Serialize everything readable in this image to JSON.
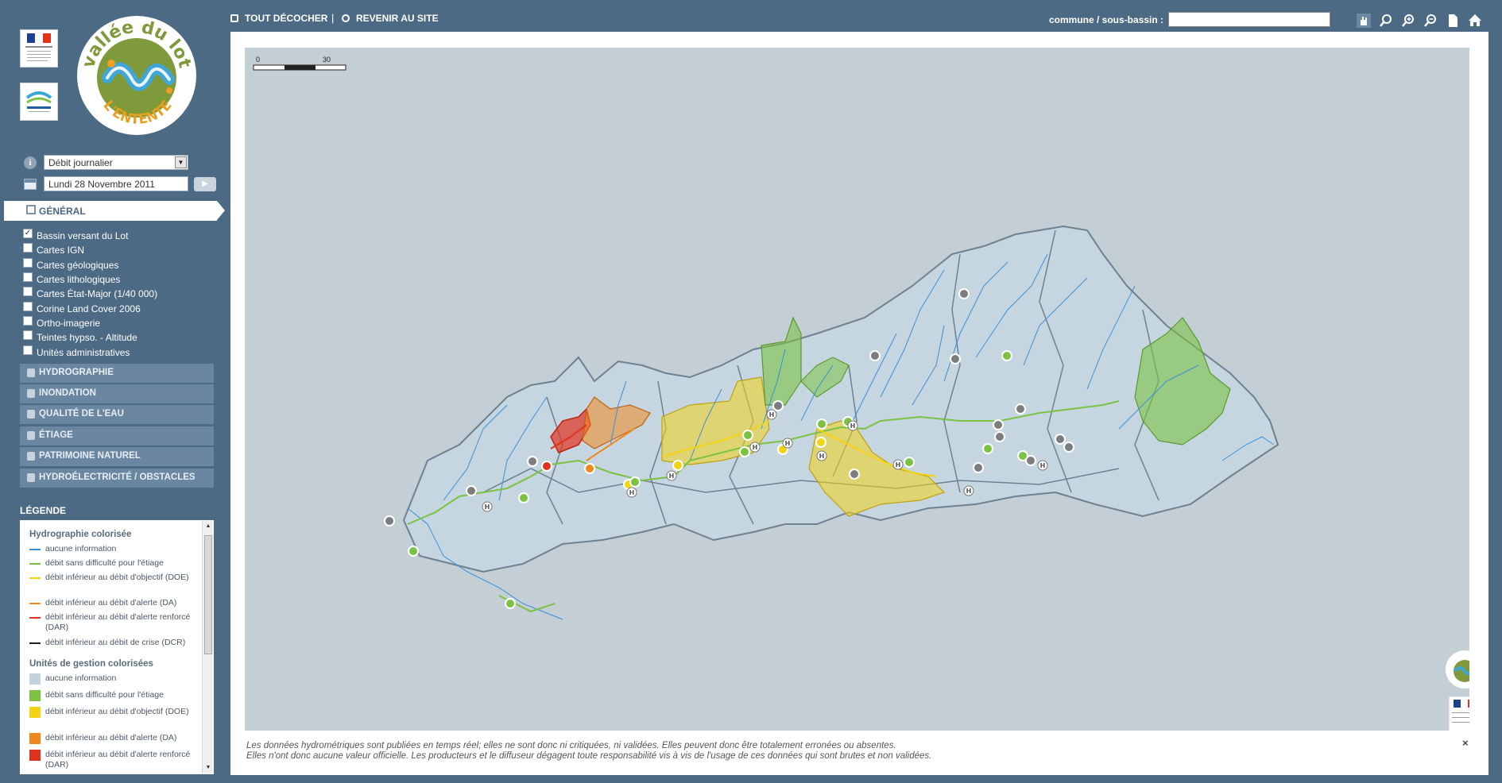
{
  "top": {
    "uncheck_all": "TOUT DÉCOCHER",
    "separator": "|",
    "back_to_site": "REVENIR AU SITE",
    "search_label": "commune / sous-bassin :",
    "search_value": ""
  },
  "logo": {
    "title_top": "vallée du lot",
    "title_bottom": "L'ENTENTE"
  },
  "controls": {
    "info_glyph": "i",
    "data_type": "Débit journalier",
    "date": "Lundi 28 Novembre 2011",
    "play_glyph": "▶"
  },
  "general": {
    "label": "GÉNÉRAL",
    "layers": [
      {
        "label": "Bassin versant du Lot",
        "checked": true
      },
      {
        "label": "Cartes IGN",
        "checked": false
      },
      {
        "label": "Cartes géologiques",
        "checked": false
      },
      {
        "label": "Cartes lithologiques",
        "checked": false
      },
      {
        "label": "Cartes État-Major (1/40 000)",
        "checked": false
      },
      {
        "label": "Corine Land Cover 2006",
        "checked": false
      },
      {
        "label": "Ortho-imagerie",
        "checked": false
      },
      {
        "label": "Teintes hypso. - Altitude",
        "checked": false
      },
      {
        "label": "Unités administratives",
        "checked": false
      }
    ]
  },
  "sections": [
    {
      "label": "HYDROGRAPHIE"
    },
    {
      "label": "INONDATION"
    },
    {
      "label": "QUALITÉ DE L'EAU"
    },
    {
      "label": "ÉTIAGE"
    },
    {
      "label": "PATRIMOINE NATUREL"
    },
    {
      "label": "HYDROÉLECTRICITÉ / OBSTACLES"
    }
  ],
  "legend": {
    "title": "LÉGENDE",
    "hydro_title": "Hydrographie colorisée",
    "hydro_items": [
      {
        "label": "aucune information",
        "color": "#3b8fd6"
      },
      {
        "label": "débit sans difficulté pour l'étiage",
        "color": "#7cc242"
      },
      {
        "label": "débit inférieur au débit d'objectif (DOE)",
        "color": "#f2d316"
      },
      {
        "label": "débit inférieur au débit d'alerte (DA)",
        "color": "#f0881e"
      },
      {
        "label": "débit inférieur au débit d'alerte renforcé (DAR)",
        "color": "#e1321e"
      },
      {
        "label": "débit inférieur au débit de crise (DCR)",
        "color": "#222222"
      }
    ],
    "units_title": "Unités de gestion colorisées",
    "units_items": [
      {
        "label": "aucune information",
        "color": "#c3d3de"
      },
      {
        "label": "débit sans difficulté pour l'étiage",
        "color": "#7cc242"
      },
      {
        "label": "débit inférieur au débit d'objectif (DOE)",
        "color": "#f2d316"
      },
      {
        "label": "débit inférieur au débit d'alerte (DA)",
        "color": "#f0881e"
      },
      {
        "label": "débit inférieur au débit d'alerte renforcé (DAR)",
        "color": "#e1321e"
      }
    ]
  },
  "map": {
    "scale_start": "0",
    "scale_end": "30 km",
    "disclaimer_line1": "Les données hydrométriques sont publiées en temps réel; elles ne sont donc ni critiquées, ni validées. Elles peuvent donc être totalement erronées ou absentes.",
    "disclaimer_line2": "Elles n'ont donc aucune valeur officielle. Les producteurs et le diffuseur dégagent toute responsabilité vis à vis de l'usage de ces données qui sont brutes et non validées.",
    "close_glyph": "×",
    "station_marker_glyph": "H",
    "colors": {
      "river": "#3b8fd6",
      "basin_fill": "#c3d3de",
      "basin_stroke": "#6e8190",
      "green": "#7cc242",
      "yellow": "#f2d316",
      "orange": "#f0881e",
      "red": "#e1321e",
      "grey_station": "#7d7d7d"
    }
  }
}
